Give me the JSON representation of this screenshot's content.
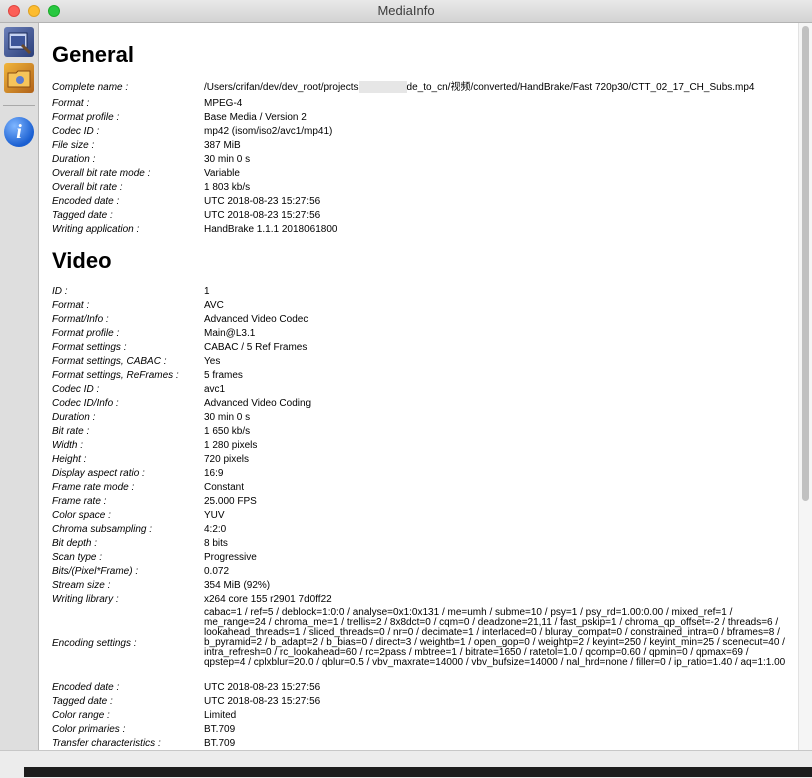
{
  "window": {
    "title": "MediaInfo"
  },
  "general": {
    "heading": "General",
    "fields": [
      {
        "label": "Complete name :",
        "value": "/Users/crifan/dev/dev_root/projects",
        "value_suffix": "de_to_cn/视频/converted/HandBrake/Fast 720p30/CTT_02_17_CH_Subs.mp4"
      },
      {
        "label": "Format :",
        "value": "MPEG-4"
      },
      {
        "label": "Format profile :",
        "value": "Base Media / Version 2"
      },
      {
        "label": "Codec ID :",
        "value": "mp42 (isom/iso2/avc1/mp41)"
      },
      {
        "label": "File size :",
        "value": "387 MiB"
      },
      {
        "label": "Duration :",
        "value": "30 min 0 s"
      },
      {
        "label": "Overall bit rate mode :",
        "value": "Variable"
      },
      {
        "label": "Overall bit rate :",
        "value": "1 803 kb/s"
      },
      {
        "label": "Encoded date :",
        "value": "UTC 2018-08-23 15:27:56"
      },
      {
        "label": "Tagged date :",
        "value": "UTC 2018-08-23 15:27:56"
      },
      {
        "label": "Writing application :",
        "value": "HandBrake 1.1.1 2018061800"
      }
    ]
  },
  "video": {
    "heading": "Video",
    "fields": [
      {
        "label": "ID :",
        "value": "1"
      },
      {
        "label": "Format :",
        "value": "AVC"
      },
      {
        "label": "Format/Info :",
        "value": "Advanced Video Codec"
      },
      {
        "label": "Format profile :",
        "value": "Main@L3.1"
      },
      {
        "label": "Format settings :",
        "value": "CABAC / 5 Ref Frames"
      },
      {
        "label": "Format settings, CABAC :",
        "value": "Yes"
      },
      {
        "label": "Format settings, ReFrames :",
        "value": "5 frames"
      },
      {
        "label": "Codec ID :",
        "value": "avc1"
      },
      {
        "label": "Codec ID/Info :",
        "value": "Advanced Video Coding"
      },
      {
        "label": "Duration :",
        "value": "30 min 0 s"
      },
      {
        "label": "Bit rate :",
        "value": "1 650 kb/s"
      },
      {
        "label": "Width :",
        "value": "1 280 pixels"
      },
      {
        "label": "Height :",
        "value": "720 pixels"
      },
      {
        "label": "Display aspect ratio :",
        "value": "16:9"
      },
      {
        "label": "Frame rate mode :",
        "value": "Constant"
      },
      {
        "label": "Frame rate :",
        "value": "25.000 FPS"
      },
      {
        "label": "Color space :",
        "value": "YUV"
      },
      {
        "label": "Chroma subsampling :",
        "value": "4:2:0"
      },
      {
        "label": "Bit depth :",
        "value": "8 bits"
      },
      {
        "label": "Scan type :",
        "value": "Progressive"
      },
      {
        "label": "Bits/(Pixel*Frame) :",
        "value": "0.072"
      },
      {
        "label": "Stream size :",
        "value": "354 MiB (92%)"
      },
      {
        "label": "Writing library :",
        "value": "x264 core 155 r2901 7d0ff22"
      }
    ],
    "encoding": {
      "label": "Encoding settings :",
      "value": "cabac=1 / ref=5 / deblock=1:0:0 / analyse=0x1:0x131 / me=umh / subme=10 / psy=1 / psy_rd=1.00:0.00 / mixed_ref=1 / me_range=24 / chroma_me=1 / trellis=2 / 8x8dct=0 / cqm=0 / deadzone=21,11 / fast_pskip=1 / chroma_qp_offset=-2 / threads=6 / lookahead_threads=1 / sliced_threads=0 / nr=0 / decimate=1 / interlaced=0 / bluray_compat=0 / constrained_intra=0 / bframes=8 / b_pyramid=2 / b_adapt=2 / b_bias=0 / direct=3 / weightb=1 / open_gop=0 / weightp=2 / keyint=250 / keyint_min=25 / scenecut=40 / intra_refresh=0 / rc_lookahead=60 / rc=2pass / mbtree=1 / bitrate=1650 / ratetol=1.0 / qcomp=0.60 / qpmin=0 / qpmax=69 / qpstep=4 / cplxblur=20.0 / qblur=0.5 / vbv_maxrate=14000 / vbv_bufsize=14000 / nal_hrd=none / filler=0 / ip_ratio=1.40 / aq=1:1.00"
    },
    "fields_after": [
      {
        "label": "Encoded date :",
        "value": "UTC 2018-08-23 15:27:56"
      },
      {
        "label": "Tagged date :",
        "value": "UTC 2018-08-23 15:27:56"
      },
      {
        "label": "Color range :",
        "value": "Limited"
      },
      {
        "label": "Color primaries :",
        "value": "BT.709"
      },
      {
        "label": "Transfer characteristics :",
        "value": "BT.709"
      }
    ]
  }
}
